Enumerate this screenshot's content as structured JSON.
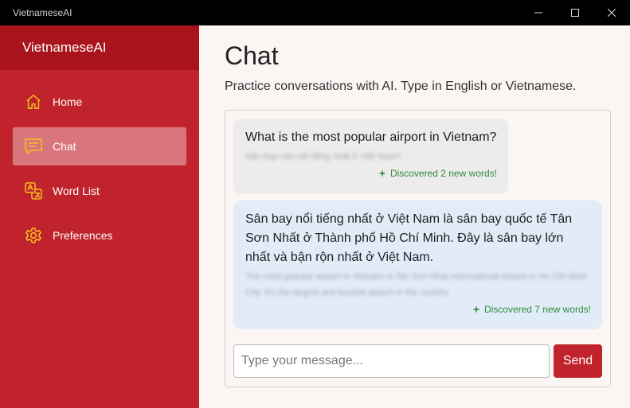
{
  "window": {
    "title": "VietnameseAI"
  },
  "sidebar": {
    "brand": "VietnameseAI",
    "items": [
      {
        "label": "Home",
        "icon": "home-icon",
        "active": false
      },
      {
        "label": "Chat",
        "icon": "chat-icon",
        "active": true
      },
      {
        "label": "Word List",
        "icon": "translate-icon",
        "active": false
      },
      {
        "label": "Preferences",
        "icon": "gear-icon",
        "active": false
      }
    ]
  },
  "main": {
    "title": "Chat",
    "subtitle": "Practice conversations with AI. Type in English or Vietnamese.",
    "messages": [
      {
        "role": "user",
        "text": "What is the most popular airport in Vietnam?",
        "translation": "Sân bay nào nổi tiếng nhất ở Việt Nam?",
        "discovered": "Discovered 2 new words!"
      },
      {
        "role": "ai",
        "text": "Sân bay nổi tiếng nhất ở Việt Nam là sân bay quốc tế Tân Sơn Nhất ở Thành phố Hồ Chí Minh. Đây là sân bay lớn nhất và bận rộn nhất ở Việt Nam.",
        "translation": "The most popular airport in Vietnam is Tan Son Nhat International Airport in Ho Chi Minh City. It's the largest and busiest airport in the country.",
        "discovered": "Discovered 7 new words!"
      }
    ],
    "input_placeholder": "Type your message...",
    "send_label": "Send"
  },
  "colors": {
    "sidebar": "#c0232b",
    "brand_bar": "#a8131c",
    "accent_icon": "#f4c01e",
    "discover_green": "#2f8a3a",
    "ai_bubble": "#e1ecf8",
    "user_bubble": "#ececec"
  }
}
